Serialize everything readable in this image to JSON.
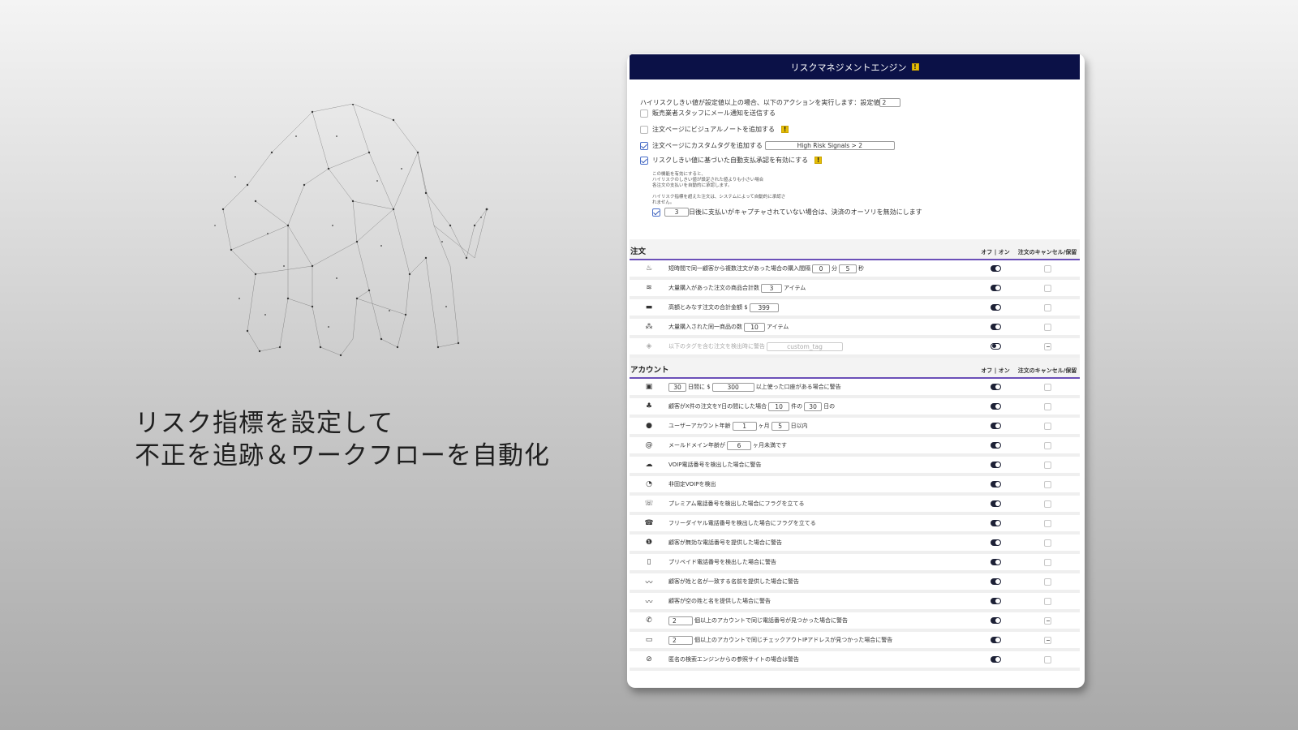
{
  "headline": {
    "line1": "リスク指標を設定して",
    "line2": "不正を追跡＆ワークフローを自動化"
  },
  "panel": {
    "title": "リスクマネジメントエンジン",
    "threshold_text": "ハイリスクしきい値が設定値以上の場合、以下のアクションを実行します：設定値",
    "threshold_value": "2",
    "actions": [
      {
        "label": "販売業者スタッフにメール通知を送信する",
        "checked": false
      },
      {
        "label": "注文ページにビジュアルノートを追加する",
        "checked": false
      },
      {
        "label": "注文ページにカスタムタグを追加する",
        "checked": true,
        "tag_value": "High Risk Signals > 2"
      },
      {
        "label": "リスクしきい値に基づいた自動支払承認を有効にする",
        "checked": true
      }
    ],
    "auto_note_1": "この機能を有効にすると、",
    "auto_note_2": "ハイリスクのしきい値が設定された値よりも小さい場合",
    "auto_note_3": "各注文の支払いを自動的に承認します。",
    "auto_note_4": "ハイリスク指標を超えた注文は、システムによって自動的に承認さ",
    "auto_note_5": "れません。",
    "void_days": "3",
    "void_label": "日後に支払いがキャプチャされていない場合は、決済のオーソリを無効にします"
  },
  "orders_section": {
    "title": "注文",
    "col_toggle": "オフ | オン",
    "col_cancel": "注文のキャンセル/保留",
    "rows": {
      "r1": {
        "pre": "短時間で同一顧客から複数注文があった場合の購入間隔",
        "v1": "0",
        "mid": "分",
        "v2": "5",
        "post": "秒",
        "icon": "fire-icon"
      },
      "r2": {
        "pre": "大量購入があった注文の商品合計数",
        "v1": "3",
        "post": "アイテム",
        "icon": "stack-icon"
      },
      "r3": {
        "pre": "高額とみなす注文の合計金額 $",
        "v1": "399",
        "icon": "wallet-icon"
      },
      "r4": {
        "pre": "大量購入された同一商品の数",
        "v1": "10",
        "post": "アイテム",
        "icon": "cubes-icon"
      },
      "r5": {
        "pre": "以下のタグを含む注文を検出時に警告",
        "v1": "custom_tag",
        "icon": "tag-icon"
      }
    }
  },
  "account_section": {
    "title": "アカウント",
    "col_toggle": "オフ | オン",
    "col_cancel": "注文のキャンセル/保留",
    "rows": {
      "a1": {
        "v1": "30",
        "mid": "日間に $",
        "v2": "300",
        "post": "以上使った口座がある場合に警告"
      },
      "a2": {
        "pre": "顧客がX件の注文をY日の間にした場合",
        "v1": "10",
        "mid": "件の",
        "v2": "30",
        "post": "日の"
      },
      "a3": {
        "pre": "ユーザーアカウント年齢",
        "v1": "1",
        "mid": "ヶ月",
        "v2": "5",
        "post": "日以内"
      },
      "a4": {
        "pre": "メールドメイン年齢が",
        "v1": "6",
        "post": "ヶ月未満です"
      },
      "a5": {
        "pre": "VOIP電話番号を検出した場合に警告"
      },
      "a6": {
        "pre": "非固定VOIPを検出"
      },
      "a7": {
        "pre": "プレミアム電話番号を検出した場合にフラグを立てる"
      },
      "a8": {
        "pre": "フリーダイヤル電話番号を検出した場合にフラグを立てる"
      },
      "a9": {
        "pre": "顧客が無効な電話番号を提供した場合に警告"
      },
      "a10": {
        "pre": "プリペイド電話番号を検出した場合に警告"
      },
      "a11": {
        "pre": "顧客が姓と名が一致する名前を提供した場合に警告"
      },
      "a12": {
        "pre": "顧客が空の姓と名を提供した場合に警告"
      },
      "a13": {
        "v1": "2",
        "post": "個以上のアカウントで同じ電話番号が見つかった場合に警告"
      },
      "a14": {
        "v1": "2",
        "post": "個以上のアカウントで同じチェックアウトIPアドレスが見つかった場合に警告"
      },
      "a15": {
        "pre": "匿名の検索エンジンからの参照サイトの場合は警告"
      }
    }
  },
  "colors": {
    "header_bg": "#0b1147",
    "accent": "#6b4fb8",
    "info": "#e7bf05"
  }
}
